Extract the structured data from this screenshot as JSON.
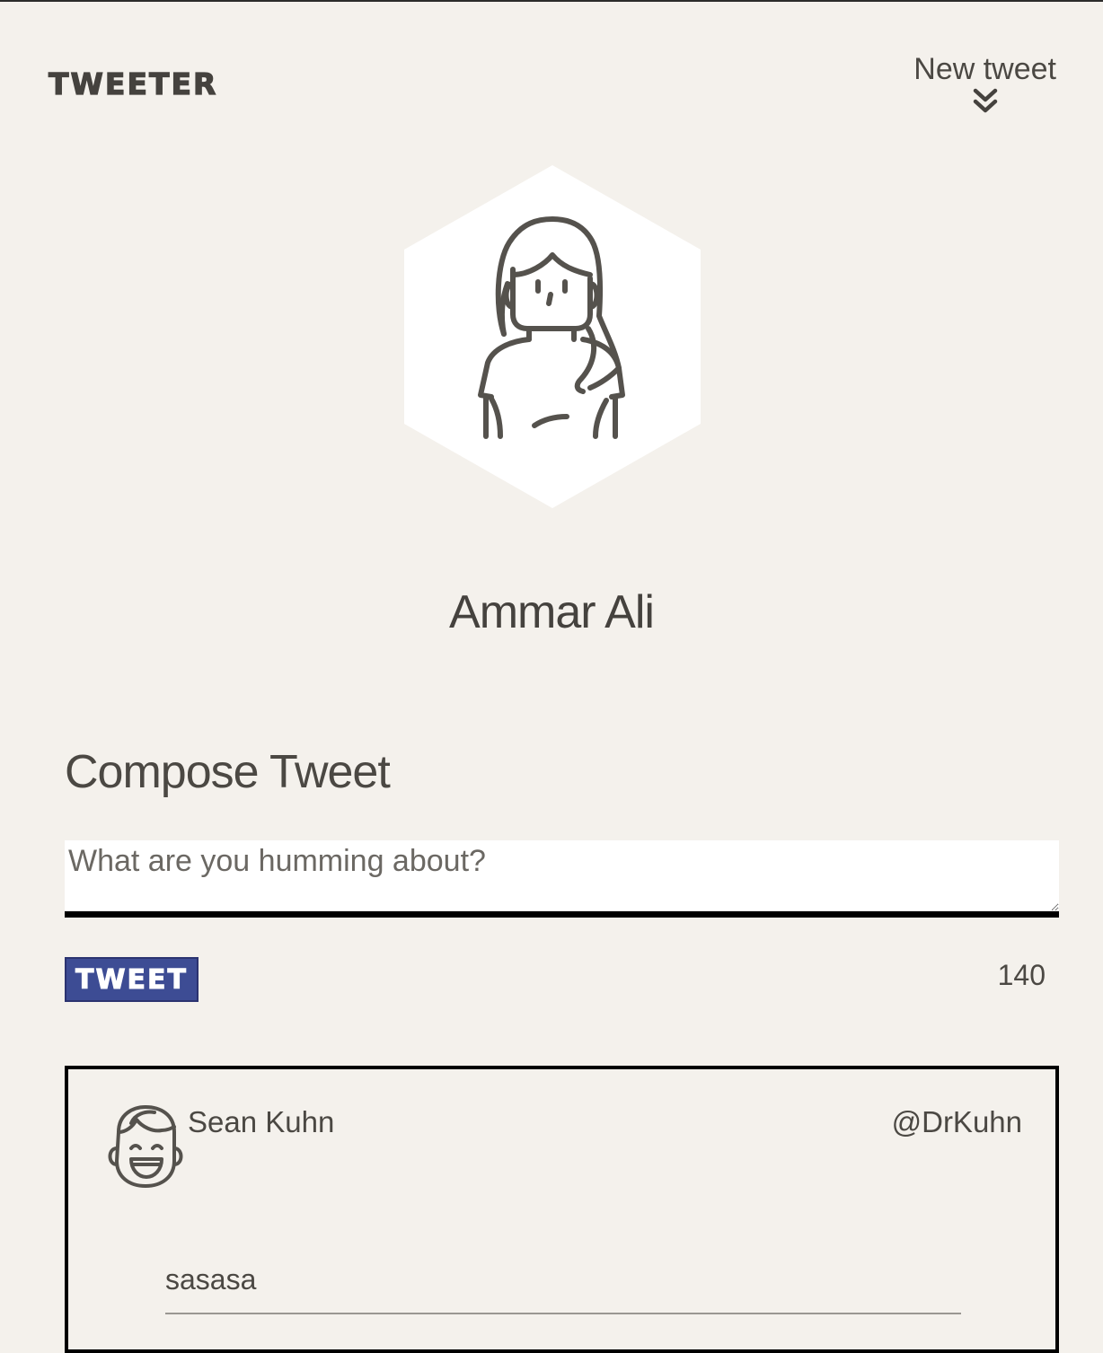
{
  "header": {
    "brand": "TWEETER",
    "new_tweet_label": "New tweet",
    "new_tweet_icon": "double-chevron-down-icon"
  },
  "profile": {
    "avatar_icon": "woman-avatar-icon",
    "name": "Ammar Ali"
  },
  "compose": {
    "title": "Compose Tweet",
    "placeholder": "What are you humming about?",
    "value": "",
    "button_label": "TWEET",
    "counter": "140"
  },
  "tweets": [
    {
      "avatar_icon": "smiling-man-avatar-icon",
      "author": "Sean Kuhn",
      "handle": "@DrKuhn",
      "content": "sasasa"
    }
  ],
  "colors": {
    "background": "#f4f1ec",
    "text": "#4b4843",
    "button": "#3d4c94",
    "card_border": "#000000"
  }
}
